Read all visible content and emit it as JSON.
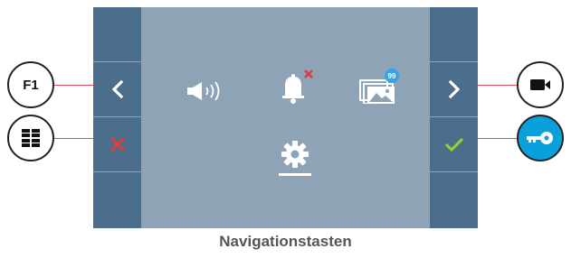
{
  "caption": "Navigationstasten",
  "menu": {
    "icons": [
      "speaker-volume-icon",
      "bell-muted-icon",
      "gallery-icon",
      "settings-gear-icon"
    ],
    "gallery_badge": "99",
    "selected": "settings-gear-icon"
  },
  "left_column": {
    "icons": [
      "chevron-left-icon",
      "close-x-icon"
    ]
  },
  "right_column": {
    "icons": [
      "chevron-right-icon",
      "checkmark-icon"
    ]
  },
  "physical_buttons": {
    "f1_label": "F1",
    "left_bottom_icon": "grid-menu-icon",
    "right_top_icon": "video-camera-icon",
    "right_bottom_icon": "key-icon"
  },
  "colors": {
    "screen": "#8ea4b6",
    "side_columns": "#4b6e8d",
    "close": "#e23b3b",
    "check": "#9bd22a",
    "key_button": "#0aa0dc",
    "badge": "#2fa6e8",
    "connector": "#e04a5e"
  }
}
